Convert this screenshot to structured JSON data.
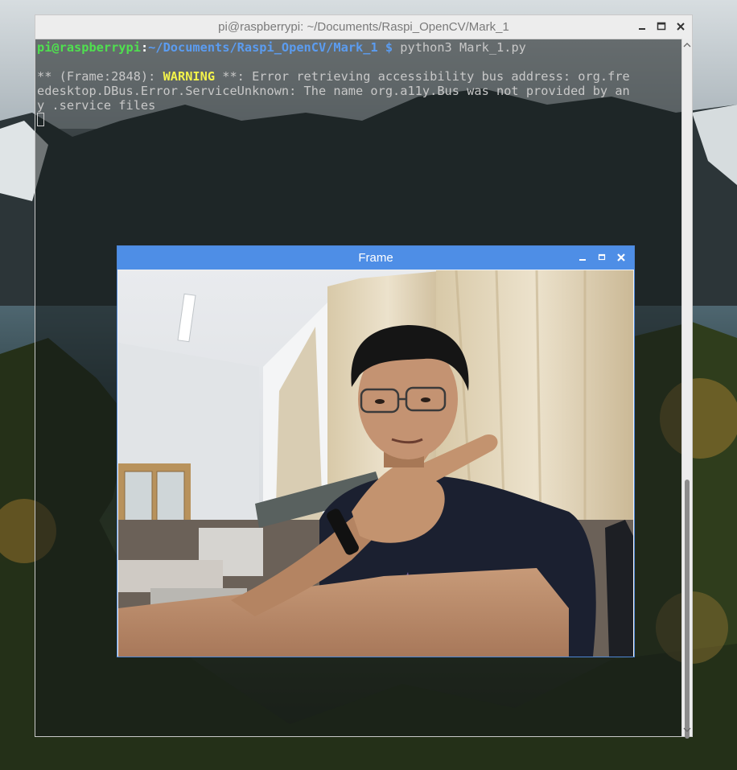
{
  "terminal": {
    "title": "pi@raspberrypi: ~/Documents/Raspi_OpenCV/Mark_1",
    "prompt_user": "pi@raspberrypi",
    "prompt_sep": ":",
    "prompt_path": "~/Documents/Raspi_OpenCV/Mark_1",
    "prompt_symbol": "$",
    "command": " python3 Mark_1.py",
    "warning_prefix": "** (Frame:2848): ",
    "warning_label": "WARNING",
    "warning_line1_rest": " **: Error retrieving accessibility bus address: org.fre",
    "warning_line2": "edesktop.DBus.Error.ServiceUnknown: The name org.a11y.Bus was not provided by an",
    "warning_line3": "y .service files"
  },
  "frame_window": {
    "title": "Frame"
  },
  "icons": {
    "minimize": "minimize-icon",
    "maximize": "maximize-icon",
    "close": "close-icon",
    "scroll_up": "scroll-up-arrow-icon",
    "scroll_down": "scroll-down-arrow-icon"
  },
  "colors": {
    "prompt_user": "#4fe04f",
    "prompt_path": "#5b9cf0",
    "warning": "#f3f34a",
    "frame_titlebar": "#4e8ee6"
  }
}
